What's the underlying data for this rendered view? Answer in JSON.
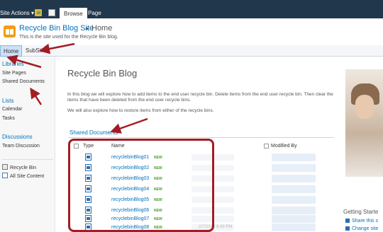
{
  "ribbon": {
    "site_actions": "Site Actions ▾",
    "tabs": [
      "Browse",
      "Page"
    ]
  },
  "header": {
    "site_title": "Recycle Bin Blog Site",
    "separator": "▸",
    "page_crumb": "Home",
    "description": "This is the site used for the Recycle Bin blog."
  },
  "topnav": [
    "Home",
    "SubSite"
  ],
  "quicklaunch": {
    "libraries_head": "Libraries",
    "libraries": [
      "Site Pages",
      "Shared Documents"
    ],
    "lists_head": "Lists",
    "lists": [
      "Calendar",
      "Tasks"
    ],
    "discussions_head": "Discussions",
    "discussions": [
      "Team Discussion"
    ],
    "recycle_bin": "Recycle Bin",
    "all_site_content": "All Site Content"
  },
  "main": {
    "title": "Recycle Bin Blog",
    "para1": "In this blog we will explore how to add items to the end user recycle bin.  Delete items from the end user recycle bin.  Then clear the items that have been deleted from the end user recycle bins.",
    "para2": "We will also explore how to restore items  from either of the recycle bins.",
    "webpart_title": "Shared Documents",
    "columns": {
      "type": "Type",
      "name": "Name",
      "modified_by": "Modified By"
    },
    "new_badge": "NEW",
    "documents": [
      "recyclebinBlog01",
      "recyclebinBlog02",
      "recyclebinBlog03",
      "recyclebinBlog04",
      "recyclebinBlog05",
      "recyclebinBlog06",
      "recyclebinBlog07",
      "recyclebinBlog08"
    ],
    "faded_date": "2/7/2012 6:49 PM"
  },
  "right": {
    "getting_started": "Getting Starte",
    "links": [
      "Share this s",
      "Change site"
    ]
  },
  "colors": {
    "ribbon": "#21374c",
    "link": "#0072bc",
    "annotation": "#a31c24"
  },
  "icons": [
    "folder-icon",
    "edit-page-icon",
    "site-logo-icon",
    "document-icon",
    "recycle-bin-icon",
    "all-site-content-icon"
  ]
}
